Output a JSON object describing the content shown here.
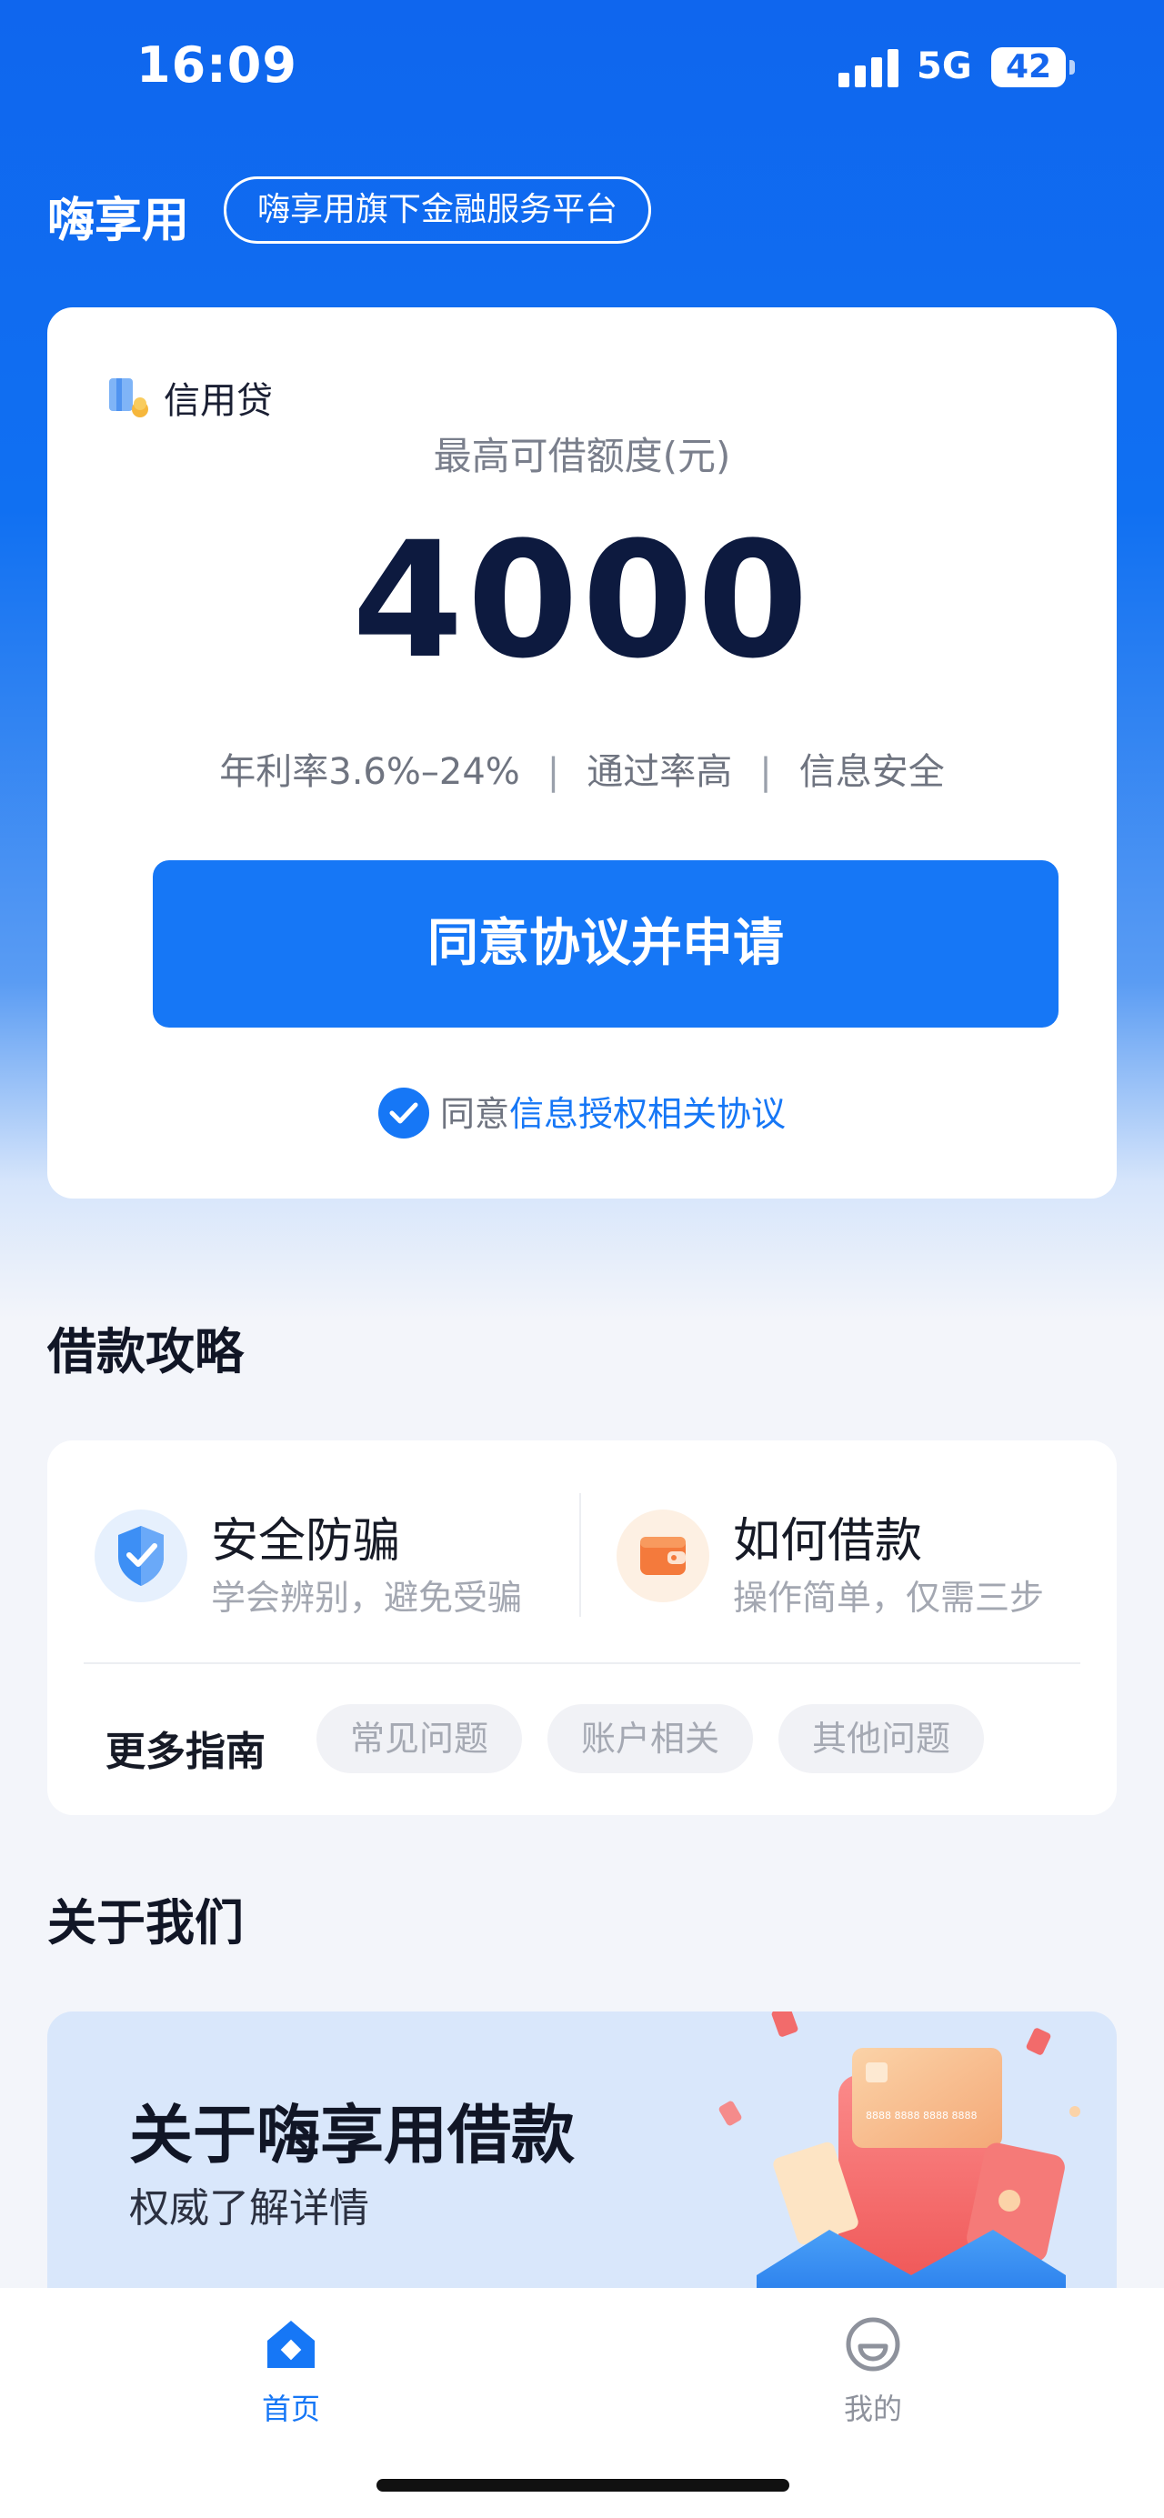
{
  "status_bar": {
    "time": "16:09",
    "network": "5G",
    "battery": "42"
  },
  "header": {
    "title": "嗨享用",
    "tag": "嗨享用旗下金融服务平台"
  },
  "credit_card": {
    "product_name": "信用贷",
    "limit_label": "最高可借额度(元)",
    "limit_amount": "4000",
    "features": [
      "年利率3.6%–24%",
      "通过率高",
      "信息安全"
    ],
    "apply_button": "同意协议并申请",
    "agree_prefix": "同意",
    "agree_link": "信息授权相关协议"
  },
  "guide": {
    "section_title": "借款攻略",
    "items": [
      {
        "title": "安全防骗",
        "subtitle": "学会辨别，避免受骗",
        "icon": "shield-check-icon"
      },
      {
        "title": "如何借款",
        "subtitle": "操作简单，仅需三步",
        "icon": "wallet-icon"
      }
    ],
    "more_label": "更多指南",
    "chips": [
      "常见问题",
      "账户相关",
      "其他问题"
    ]
  },
  "about": {
    "section_title": "关于我们",
    "title": "关于嗨享用借款",
    "subtitle": "权威了解详情",
    "card_number": "8888 8888 8888 8888"
  },
  "tab_bar": {
    "tabs": [
      {
        "label": "首页",
        "icon": "home-icon",
        "active": true
      },
      {
        "label": "我的",
        "icon": "profile-icon",
        "active": false
      }
    ]
  },
  "colors": {
    "primary": "#1677f6",
    "text_dark": "#111626",
    "text_gray": "#a3a7b1"
  }
}
